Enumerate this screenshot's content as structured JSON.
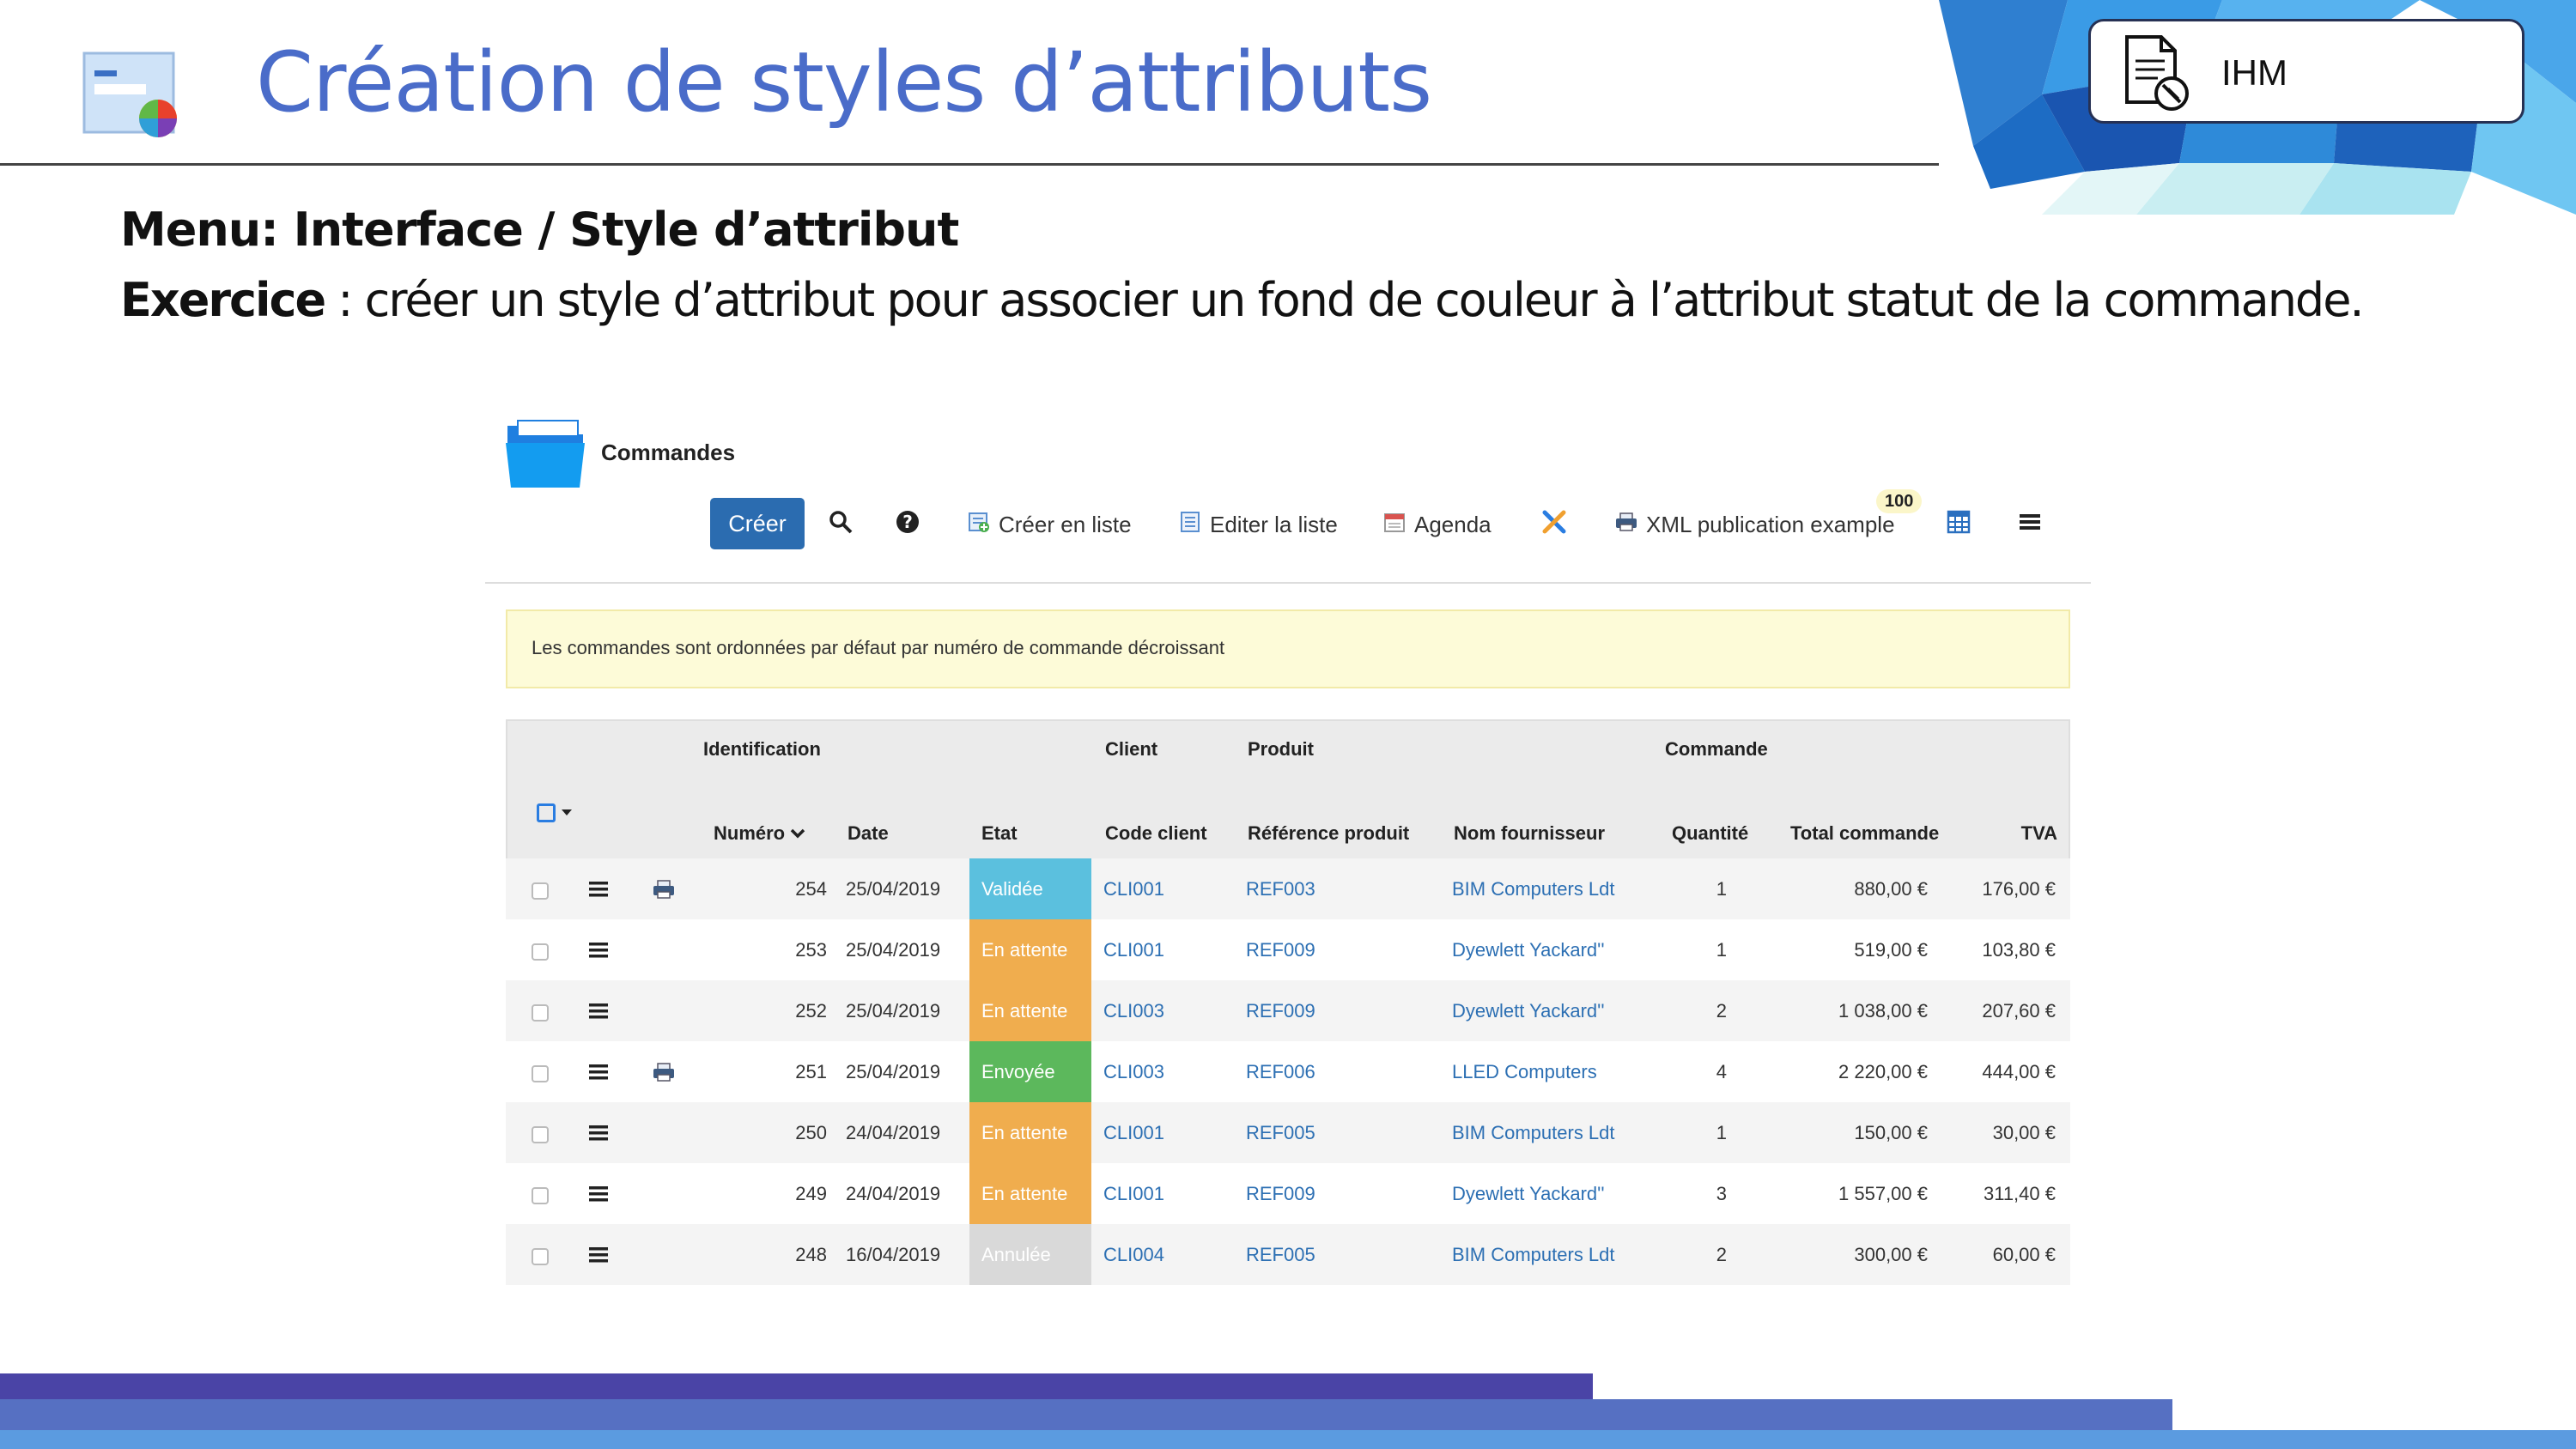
{
  "slide": {
    "title": "Création de styles d’attributs",
    "tag": "IHM",
    "menu_line": "Menu: Interface / Style d’attribut",
    "exercise_label": "Exercice",
    "exercise_text": " : créer un style d’attribut pour associer un fond de couleur à l’attribut statut de la commande."
  },
  "app": {
    "title": "Commandes",
    "toolbar": {
      "create": "Créer",
      "create_list": "Créer en liste",
      "edit_list": "Editer la liste",
      "agenda": "Agenda",
      "xml": "XML publication example",
      "badge": "100"
    },
    "info": "Les commandes sont ordonnées par défaut par numéro de commande décroissant",
    "groups": {
      "identification": "Identification",
      "client": "Client",
      "produit": "Produit",
      "commande": "Commande"
    },
    "columns": {
      "numero": "Numéro",
      "date": "Date",
      "etat": "Etat",
      "code_client": "Code client",
      "ref": "Référence produit",
      "fournisseur": "Nom fournisseur",
      "quantite": "Quantité",
      "total": "Total commande",
      "tva": "TVA"
    },
    "rows": [
      {
        "numero": "254",
        "date": "25/04/2019",
        "etat": "Validée",
        "client": "CLI001",
        "ref": "REF003",
        "fournisseur": "BIM Computers Ldt",
        "quantite": "1",
        "total": "880,00 €",
        "tva": "176,00 €"
      },
      {
        "numero": "253",
        "date": "25/04/2019",
        "etat": "En attente",
        "client": "CLI001",
        "ref": "REF009",
        "fournisseur": "Dyewlett Yackard''",
        "quantite": "1",
        "total": "519,00 €",
        "tva": "103,80 €"
      },
      {
        "numero": "252",
        "date": "25/04/2019",
        "etat": "En attente",
        "client": "CLI003",
        "ref": "REF009",
        "fournisseur": "Dyewlett Yackard''",
        "quantite": "2",
        "total": "1 038,00 €",
        "tva": "207,60 €"
      },
      {
        "numero": "251",
        "date": "25/04/2019",
        "etat": "Envoyée",
        "client": "CLI003",
        "ref": "REF006",
        "fournisseur": "LLED Computers",
        "quantite": "4",
        "total": "2 220,00 €",
        "tva": "444,00 €"
      },
      {
        "numero": "250",
        "date": "24/04/2019",
        "etat": "En attente",
        "client": "CLI001",
        "ref": "REF005",
        "fournisseur": "BIM Computers Ldt",
        "quantite": "1",
        "total": "150,00 €",
        "tva": "30,00 €"
      },
      {
        "numero": "249",
        "date": "24/04/2019",
        "etat": "En attente",
        "client": "CLI001",
        "ref": "REF009",
        "fournisseur": "Dyewlett Yackard''",
        "quantite": "3",
        "total": "1 557,00 €",
        "tva": "311,40 €"
      },
      {
        "numero": "248",
        "date": "16/04/2019",
        "etat": "Annulée",
        "client": "CLI004",
        "ref": "REF005",
        "fournisseur": "BIM Computers Ldt",
        "quantite": "2",
        "total": "300,00 €",
        "tva": "60,00 €"
      }
    ]
  },
  "colors": {
    "title": "#4a6cc9",
    "button": "#2b6cb0",
    "link": "#2c6fb3",
    "status_validee": "#5bc0de",
    "status_en_attente": "#f0ad4e",
    "status_envoyee": "#5cb85c",
    "status_annulee": "#d9d9d9"
  }
}
